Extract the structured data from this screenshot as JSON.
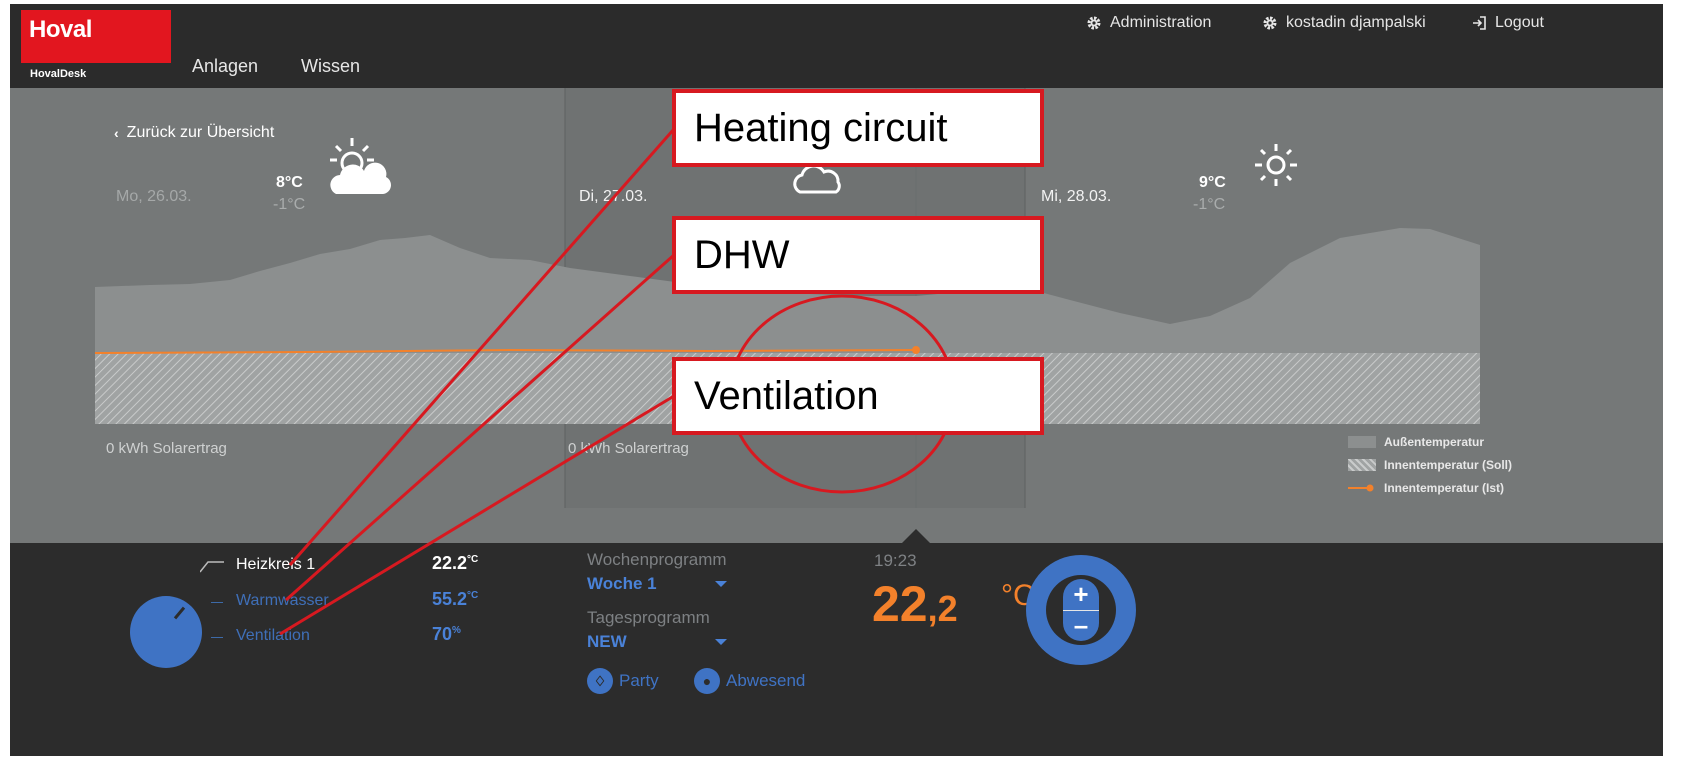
{
  "header": {
    "logo": "Hoval",
    "logo_sub": "HovalDesk",
    "nav": [
      "Anlagen",
      "Wissen"
    ],
    "admin": "Administration",
    "user": "kostadin djampalski",
    "logout": "Logout"
  },
  "back_link": "Zurück zur Übersicht",
  "days": [
    {
      "label": "Mo, 26.03.",
      "max": "8°C",
      "min": "-1°C",
      "icon": "partly-cloudy-icon",
      "solar": "0 kWh Solarertrag"
    },
    {
      "label": "Di, 27.03.",
      "max": "",
      "min": "",
      "icon": "cloud-icon",
      "solar": "0 kWh Solarertrag"
    },
    {
      "label": "Mi, 28.03.",
      "max": "9°C",
      "min": "-1°C",
      "icon": "sun-icon",
      "solar": ""
    }
  ],
  "legend": [
    "Außentemperatur",
    "Innentemperatur (Soll)",
    "Innentemperatur (Ist)"
  ],
  "colors": {
    "brand": "#e2161f",
    "accent": "#3f73c4",
    "orange": "#f3812b",
    "annotation": "#d71920"
  },
  "circuits": [
    {
      "label": "Heizkreis 1",
      "value": "22.2",
      "unit": "°C"
    },
    {
      "label": "Warmwasser",
      "value": "55.2",
      "unit": "°C"
    },
    {
      "label": "Ventilation",
      "value": "70",
      "unit": "%"
    }
  ],
  "program": {
    "weekly_label": "Wochenprogramm",
    "weekly_value": "Woche 1",
    "daily_label": "Tagesprogramm",
    "daily_value": "NEW",
    "party": "Party",
    "absent": "Abwesend"
  },
  "current": {
    "time": "19:23",
    "temp_int": "22",
    "temp_dec": ",2",
    "unit": "°C"
  },
  "annotations": [
    "Heating circuit",
    "DHW",
    "Ventilation"
  ]
}
